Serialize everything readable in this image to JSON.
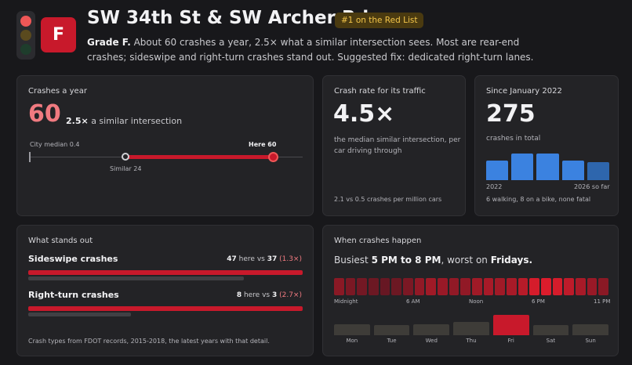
{
  "header": {
    "grade_letter": "F",
    "title": "SW 34th St & SW Archer Rd",
    "rank_badge": "#1 on the Red List",
    "summary_grade": "Grade F.",
    "summary_text": " About 60 crashes a year, 2.5× what a similar intersection sees. Most are rear-end crashes; sideswipe and right-turn crashes stand out. Suggested fix: dedicated right-turn lanes."
  },
  "crashes_year": {
    "title": "Crashes a year",
    "value": "60",
    "multiplier": "2.5×",
    "multiplier_text": " a similar intersection",
    "city_median_label": "City median 0.4",
    "here_label": "Here 60",
    "similar_label": "Similar 24",
    "scale": {
      "city_median": 0.4,
      "similar": 24,
      "here": 60,
      "max": 70
    }
  },
  "crash_rate": {
    "title": "Crash rate for its traffic",
    "value": "4.5×",
    "description": "the median similar intersection, per car driving through",
    "footnote": "2.1 vs 0.5 crashes per million cars"
  },
  "since": {
    "title": "Since January 2022",
    "value": "275",
    "subtitle": "crashes in total",
    "bars": [
      0.5,
      0.68,
      0.68,
      0.5,
      0.45
    ],
    "bar_colors": [
      "#3b82e0",
      "#3b82e0",
      "#3b82e0",
      "#3b82e0",
      "#2e66ad"
    ],
    "start_label": "2022",
    "end_label": "2026 so far",
    "footnote": "6 walking, 8 on a bike, none fatal"
  },
  "stands_out": {
    "title": "What stands out",
    "items": [
      {
        "label": "Sideswipe crashes",
        "here": "47",
        "vs_text": " here vs ",
        "similar": "37",
        "ratio": "(1.3×)",
        "here_frac": 1.0,
        "similar_frac": 0.787
      },
      {
        "label": "Right-turn crashes",
        "here": "8",
        "vs_text": " here vs ",
        "similar": "3",
        "ratio": "(2.7×)",
        "here_frac": 1.0,
        "similar_frac": 0.375
      }
    ],
    "footnote": "Crash types from FDOT records, 2015-2018, the latest years with that detail."
  },
  "when": {
    "title": "When crashes happen",
    "busiest_prefix": "Busiest ",
    "busiest_time": "5 PM to 8 PM",
    "busiest_mid": ", worst on ",
    "busiest_day": "Fridays.",
    "hour_intensity": [
      0.45,
      0.35,
      0.3,
      0.25,
      0.22,
      0.25,
      0.35,
      0.5,
      0.6,
      0.55,
      0.5,
      0.5,
      0.6,
      0.65,
      0.6,
      0.65,
      0.75,
      0.95,
      1.0,
      0.95,
      0.8,
      0.65,
      0.55,
      0.45
    ],
    "hour_labels": [
      "Midnight",
      "6 AM",
      "Noon",
      "6 PM",
      "11 PM"
    ],
    "days": [
      {
        "label": "Mon",
        "value": 0.55
      },
      {
        "label": "Tue",
        "value": 0.5
      },
      {
        "label": "Wed",
        "value": 0.55
      },
      {
        "label": "Thu",
        "value": 0.65
      },
      {
        "label": "Fri",
        "value": 1.0
      },
      {
        "label": "Sat",
        "value": 0.5
      },
      {
        "label": "Sun",
        "value": 0.55
      }
    ],
    "peak_day_color": "#c8192b",
    "day_color": "#3e3c38"
  }
}
